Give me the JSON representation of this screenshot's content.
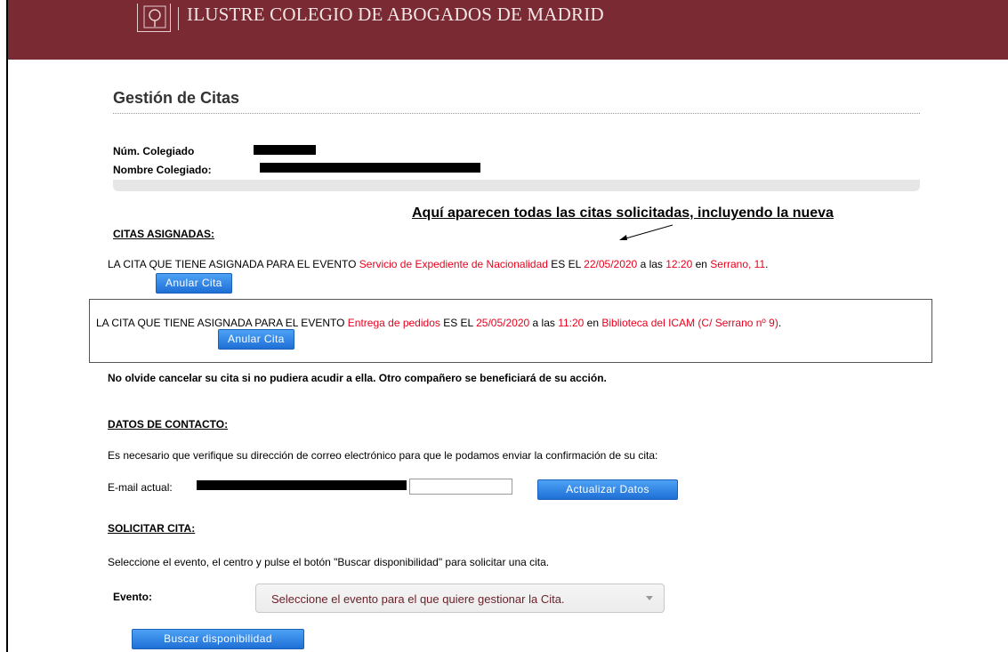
{
  "header": {
    "title": "ILUSTRE COLEGIO DE ABOGADOS DE MADRID"
  },
  "page": {
    "title": "Gestión de Citas"
  },
  "profile": {
    "num_label": "Núm. Colegiado",
    "name_label": "Nombre Colegiado:"
  },
  "annotation": "Aquí aparecen todas las citas solicitadas, incluyendo la nueva",
  "citas": {
    "heading": "CITAS ASIGNADAS:",
    "items": [
      {
        "prefix": "LA CITA QUE TIENE ASIGNADA PARA EL EVENTO ",
        "event": "Servicio de Expediente de Nacionalidad",
        "mid1": " ES EL ",
        "date": "22/05/2020",
        "mid2": " a las ",
        "time": "12:20",
        "mid3": " en ",
        "place": "Serrano, 11",
        "end": ".",
        "button": "Anular Cita"
      },
      {
        "prefix": "LA CITA QUE TIENE ASIGNADA PARA EL EVENTO ",
        "event": "Entrega de pedidos",
        "mid1": " ES EL ",
        "date": "25/05/2020",
        "mid2": " a las ",
        "time": "11:20",
        "mid3": " en ",
        "place": "Biblioteca del ICAM (C/ Serrano nº 9)",
        "end": ".",
        "button": "Anular Cita"
      }
    ],
    "warning": "No olvide cancelar su cita si no pudiera acudir a ella. Otro compañero se beneficiará de su acción."
  },
  "contacto": {
    "heading": "DATOS DE CONTACTO:",
    "instructions": "Es necesario que verifique su dirección de correo electrónico para que le podamos enviar la confirmación de su cita:",
    "email_label": "E-mail actual:",
    "email_input_value": "",
    "update_button": "Actualizar Datos"
  },
  "solicitar": {
    "heading": "SOLICITAR CITA:",
    "instructions": "Seleccione el evento, el centro y pulse el botón \"Buscar disponibilidad\" para solicitar una cita.",
    "event_label": "Evento:",
    "event_select_placeholder": "Seleccione el evento para el que quiere gestionar la Cita.",
    "search_button": "Buscar disponibilidad"
  },
  "colors": {
    "header_bg": "#7a2a33",
    "accent_red": "#e8001c",
    "button_blue": "#1f6fd6"
  }
}
